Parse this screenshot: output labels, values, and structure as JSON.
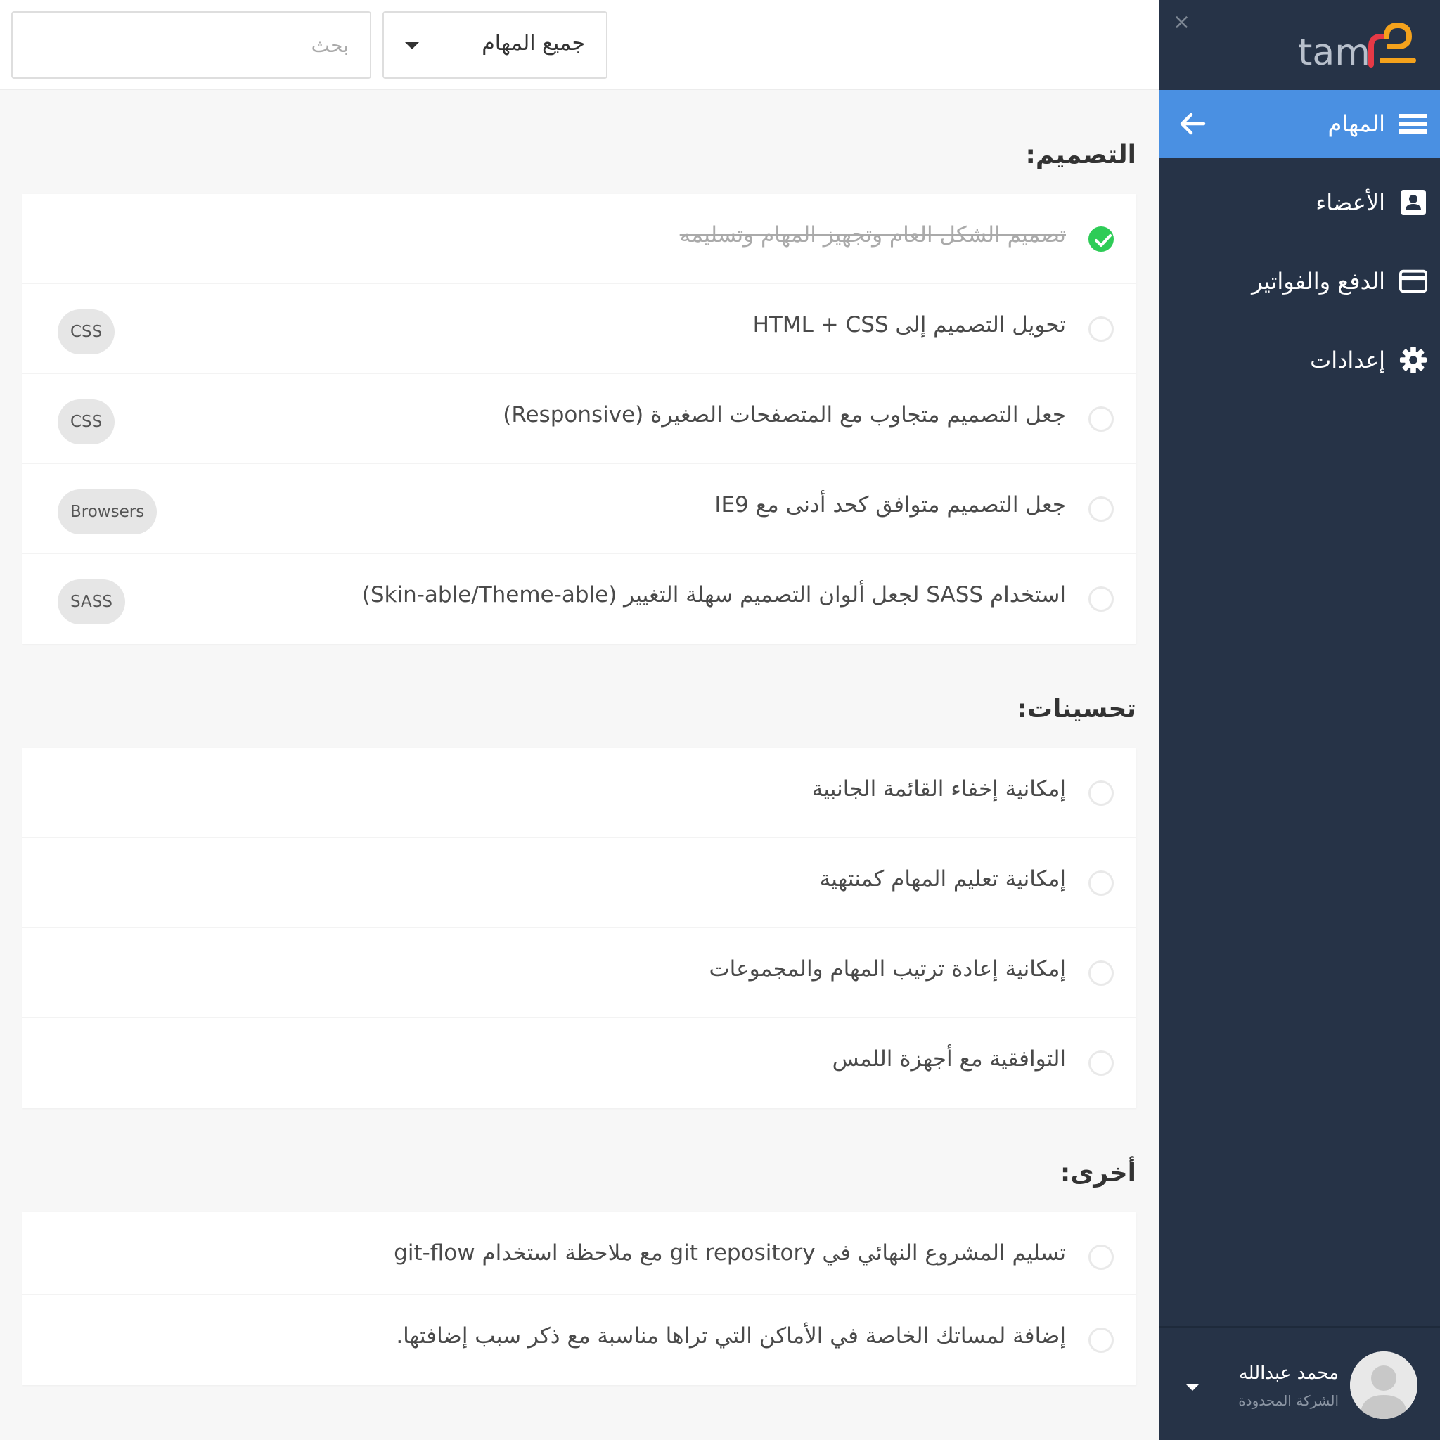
{
  "sidebar": {
    "logo_text": "tam",
    "close_glyph": "×",
    "nav": [
      {
        "label": "المهام",
        "icon": "hamburger-icon",
        "active": true
      },
      {
        "label": "الأعضاء",
        "icon": "contact-card-icon",
        "active": false
      },
      {
        "label": "الدفع والفواتير",
        "icon": "credit-card-icon",
        "active": false
      },
      {
        "label": "إعدادات",
        "icon": "gear-icon",
        "active": false
      }
    ],
    "user": {
      "name": "محمد عبدالله",
      "company": "الشركة المحدودة"
    }
  },
  "topbar": {
    "search_placeholder": "بحث",
    "filter_value": "جميع المهام"
  },
  "groups": [
    {
      "title": "التصميم:",
      "tasks": [
        {
          "text": "تصميم الشكل العام وتجهيز المهام وتسليمه",
          "done": true,
          "tag": ""
        },
        {
          "text": "تحويل التصميم إلى HTML + CSS",
          "done": false,
          "tag": "CSS"
        },
        {
          "text": "جعل التصميم متجاوب مع المتصفحات الصغيرة (Responsive)",
          "done": false,
          "tag": "CSS"
        },
        {
          "text": "جعل التصميم متوافق كحد أدنى مع IE9",
          "done": false,
          "tag": "Browsers"
        },
        {
          "text": "استخدام SASS لجعل ألوان التصميم سهلة التغيير (Skin-able/Theme-able)",
          "done": false,
          "tag": "SASS"
        }
      ]
    },
    {
      "title": "تحسينات:",
      "tasks": [
        {
          "text": "إمكانية إخفاء القائمة الجانبية",
          "done": false,
          "tag": ""
        },
        {
          "text": "إمكانية تعليم المهام كمنتهية",
          "done": false,
          "tag": ""
        },
        {
          "text": "إمكانية إعادة ترتيب المهام والمجموعات",
          "done": false,
          "tag": ""
        },
        {
          "text": "التوافقية مع أجهزة اللمس",
          "done": false,
          "tag": ""
        }
      ]
    },
    {
      "title": "أخرى:",
      "tasks": [
        {
          "text": "تسليم المشروع النهائي في git repository مع ملاحظة استخدام git-flow",
          "done": false,
          "tag": ""
        },
        {
          "text": "إضافة لمساتك الخاصة في الأماكن التي تراها مناسبة مع ذكر سبب إضافتها.",
          "done": false,
          "tag": ""
        }
      ]
    }
  ],
  "colors": {
    "sidebar_bg": "#263347",
    "active_nav": "#4a90e2",
    "done_check": "#2ecc57",
    "logo_gray": "#b8c0cc",
    "logo_red": "#e63946",
    "logo_orange": "#f4a21c"
  }
}
